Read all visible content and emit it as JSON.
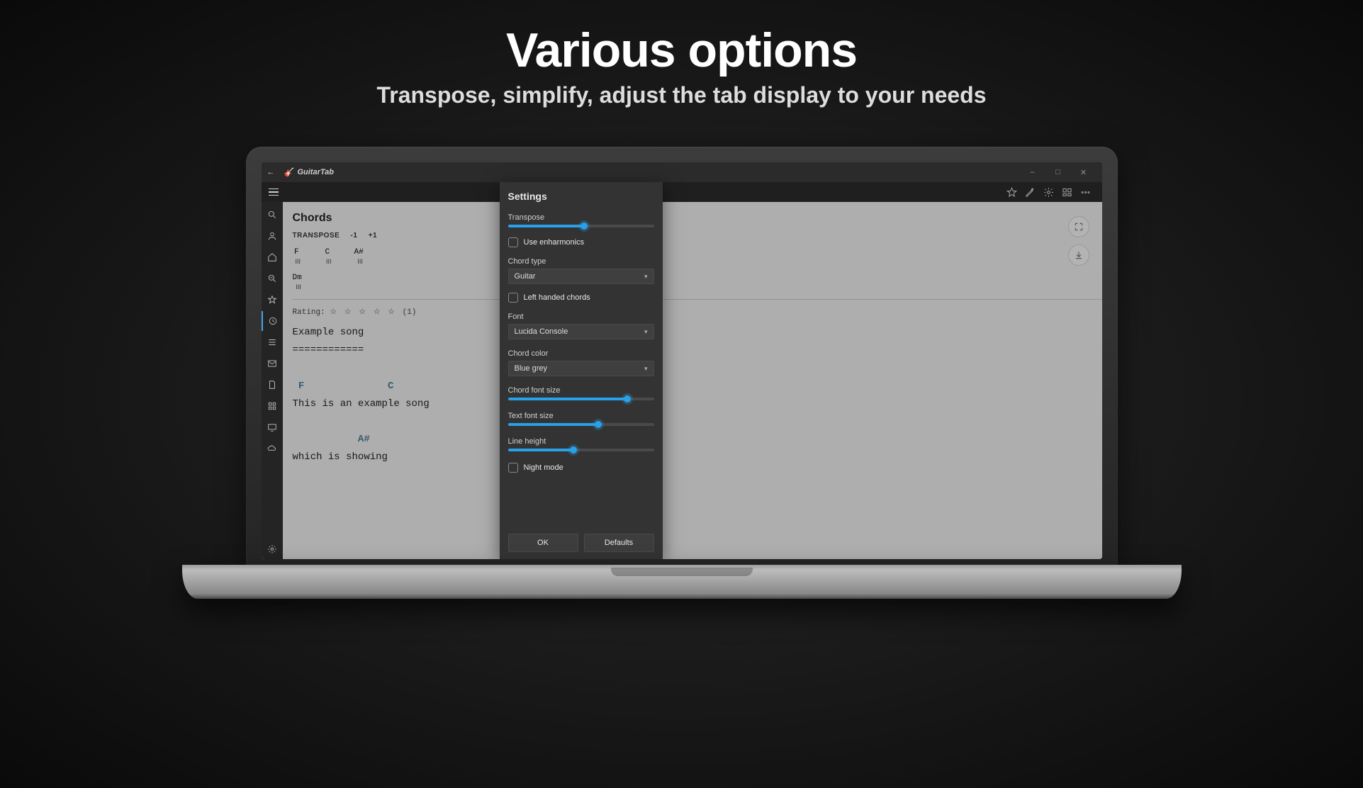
{
  "promo": {
    "title": "Various options",
    "subtitle": "Transpose, simplify, adjust the tab display to your needs"
  },
  "titlebar": {
    "app_name": "GuitarTab"
  },
  "main": {
    "chords_title": "Chords",
    "transpose_label": "TRANSPOSE",
    "transpose_minus": "-1",
    "transpose_plus": "+1",
    "chords": [
      "F",
      "C",
      "A#",
      "Dm"
    ],
    "rating_label": "Rating:",
    "rating_count": "(1)",
    "song_title": "Example song",
    "separator": "============",
    "line1_chords": {
      "c1": "F",
      "c2": "C"
    },
    "line1_text": "This is an example song",
    "line2_chord": "A#",
    "line2_text": "which is showing"
  },
  "settings": {
    "title": "Settings",
    "transpose_label": "Transpose",
    "transpose_pct": 52,
    "use_enharmonics_label": "Use enharmonics",
    "chord_type_label": "Chord type",
    "chord_type_value": "Guitar",
    "left_handed_label": "Left handed chords",
    "font_label": "Font",
    "font_value": "Lucida Console",
    "chord_color_label": "Chord color",
    "chord_color_value": "Blue grey",
    "chord_font_size_label": "Chord font size",
    "chord_font_size_pct": 82,
    "text_font_size_label": "Text font size",
    "text_font_size_pct": 62,
    "line_height_label": "Line height",
    "line_height_pct": 45,
    "night_mode_label": "Night mode",
    "ok_label": "OK",
    "defaults_label": "Defaults"
  }
}
